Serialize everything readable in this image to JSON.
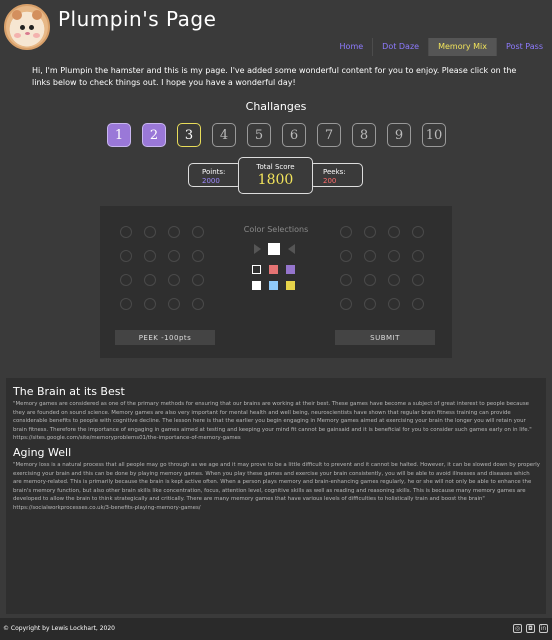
{
  "site": {
    "title": "Plumpin's Page"
  },
  "nav": {
    "tabs": [
      {
        "label": "Home",
        "active": false
      },
      {
        "label": "Dot Daze",
        "active": false
      },
      {
        "label": "Memory Mix",
        "active": true
      },
      {
        "label": "Post Pass",
        "active": false
      }
    ]
  },
  "intro": "Hi, I'm Plumpin the hamster and this is my page. I've added some wonderful content for you to enjoy. Please click on the links below to check things out. I hope you have a wonderful day!",
  "challenges": {
    "title": "Challanges",
    "levels": [
      {
        "label": "1",
        "state": "done"
      },
      {
        "label": "2",
        "state": "done"
      },
      {
        "label": "3",
        "state": "current"
      },
      {
        "label": "4",
        "state": "locked"
      },
      {
        "label": "5",
        "state": "locked"
      },
      {
        "label": "6",
        "state": "locked"
      },
      {
        "label": "7",
        "state": "locked"
      },
      {
        "label": "8",
        "state": "locked"
      },
      {
        "label": "9",
        "state": "locked"
      },
      {
        "label": "10",
        "state": "locked"
      }
    ]
  },
  "stats": {
    "points_label": "Points:",
    "points_value": "2000",
    "total_label": "Total Score",
    "total_value": "1800",
    "peeks_label": "Peeks:",
    "peeks_value": "200"
  },
  "game": {
    "selection_title": "Color Selections",
    "current_color": "#ffffff",
    "swatches": [
      "outline",
      "#e57373",
      "#9575cd",
      "#ffffff",
      "#90caf9",
      "#e6d34a"
    ],
    "peek_label": "PEEK -100pts",
    "submit_label": "SUBMIT"
  },
  "articles": [
    {
      "title": "The Brain at its Best",
      "body": "\"Memory games are considered as one of the primary methods for ensuring that our brains are working at their best. These games have become a subject of great interest to people because they are founded on sound science. Memory games are also very important for mental health and well being, neuroscientists have shown that regular brain fitness training can provide considerable benefits to people with cognitive decline. The lesson here is that the earlier you begin engaging in Memory games aimed at exercising your brain the longer you will retain your brain fitness. Therefore the importance of engaging in games aimed at testing and keeping your mind fit cannot be gainsaid and it is beneficial for you to consider such games early on in life.\"",
      "link": "https://sites.google.com/site/memoryproblems01/the-importance-of-memory-games"
    },
    {
      "title": "Aging Well",
      "body": "\"Memory loss is a natural process that all people may go through as we age and it may prove to be a little difficult to prevent and it cannot be halted. However, it can be slowed down by properly exercising your brain and this can be done by playing memory games. When you play these games and exercise your brain consistently, you will be able to avoid illnesses and diseases which are memory-related. This is primarily because the brain is kept active often. When a person plays memory and brain-enhancing games regularly, he or she will not only be able to enhance the brain's memory function, but also other brain skills like concentration, focus, attention level, cognitive skills as well as reading and reasoning skills. This is because many memory games are developed to allow the brain to think strategically and critically. There are many memory games that have various levels of difficulties to holistically train and boost the brain\"",
      "link": "https://socialworkprocesses.co.uk/3-benefits-playing-memory-games/"
    }
  ],
  "footer": {
    "copyright": "© Copyright by Lewis Lockhart, 2020",
    "social": [
      {
        "icon": "github-icon",
        "glyph": "◎"
      },
      {
        "icon": "instagram-icon",
        "glyph": "◘"
      },
      {
        "icon": "linkedin-icon",
        "glyph": "in"
      }
    ]
  }
}
